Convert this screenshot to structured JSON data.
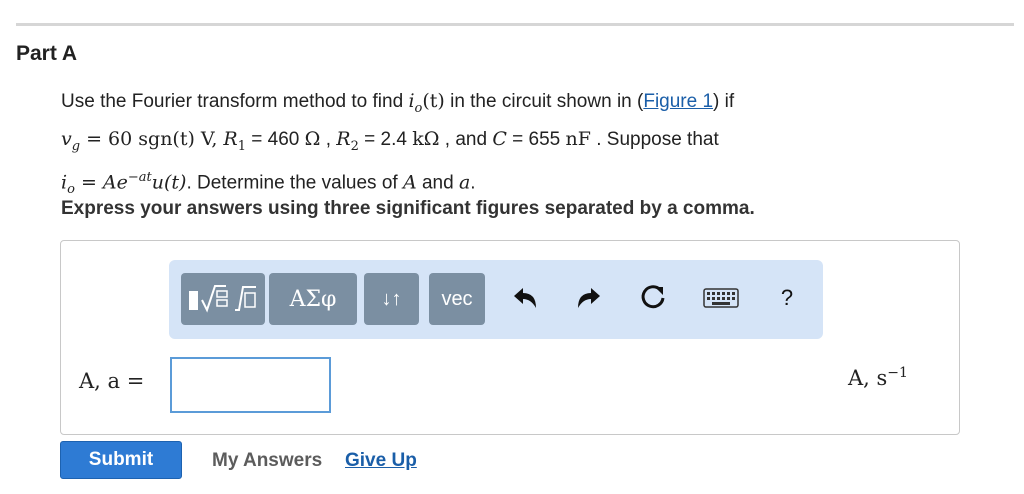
{
  "part": {
    "title": "Part A"
  },
  "problem": {
    "t1": "Use the Fourier transform method to find ",
    "io_sym": "i",
    "io_sub": "o",
    "t_of": "(t)",
    "t2": " in the circuit shown in (",
    "figure_link": "Figure 1",
    "t3": ") if",
    "vg_sym": "v",
    "vg_sub": "g",
    "vg_rhs": " = 60 sgn(t) V, ",
    "r1_sym": "R",
    "r1_sub": "1",
    "r1_val": " = 460 ",
    "r1_unit": " Ω",
    "sep1": " , ",
    "r2_sym": "R",
    "r2_sub": "2",
    "r2_val": " = 2.4 ",
    "r2_unit": " kΩ",
    "t4": " , and ",
    "c_sym": "C",
    "c_val": " = 655 ",
    "c_unit": " nF",
    "t5": " . Suppose that",
    "io2_sym": "i",
    "io2_sub": "o",
    "eq": " = ",
    "A_e": "Ae",
    "exp": "−at",
    "u_t": "u(t)",
    "t6": ". Determine the values of ",
    "A": "A",
    "and": " and ",
    "a": "a",
    "period": "."
  },
  "instruction": "Express your answers using three significant figures separated by a comma.",
  "toolbar": {
    "greek_label": "ΑΣφ",
    "arrows_label": "↓↑",
    "vec_label": "vec",
    "help_label": "?"
  },
  "answer": {
    "label": "A, a =",
    "value": "",
    "placeholder": "",
    "units": "A, s",
    "units_exp": "−1"
  },
  "actions": {
    "submit": "Submit",
    "my_answers": "My Answers",
    "give_up": "Give Up"
  },
  "colors": {
    "link": "#1a5ea8",
    "submit_bg": "#2e7bd4",
    "toolbar_bg": "#d5e4f7",
    "toolbar_btn": "#7b8fa2",
    "input_border": "#5b9bd8"
  }
}
